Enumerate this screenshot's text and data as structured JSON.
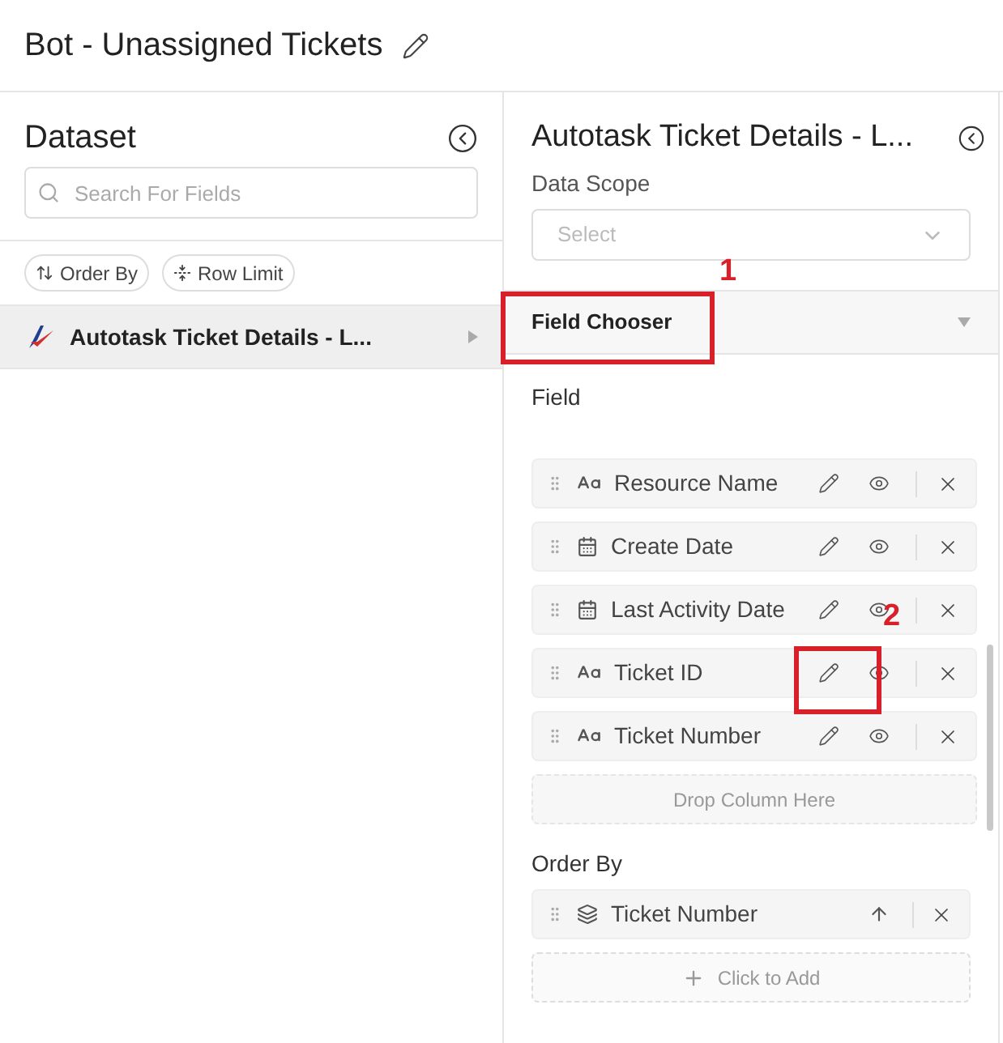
{
  "header": {
    "title": "Bot - Unassigned Tickets"
  },
  "dataset_panel": {
    "title": "Dataset",
    "search": {
      "placeholder": "Search For Fields"
    },
    "chips": [
      {
        "label": "Order By",
        "kind": "sort"
      },
      {
        "label": "Row Limit",
        "kind": "limit"
      }
    ],
    "datasets": [
      {
        "name": "Autotask Ticket Details - L...",
        "selected": true
      }
    ]
  },
  "details_panel": {
    "title": "Autotask Ticket Details - L...",
    "data_scope": {
      "label": "Data Scope",
      "placeholder": "Select"
    },
    "field_chooser": {
      "title": "Field Chooser",
      "expanded": true
    },
    "fields_label": "Field",
    "fields": [
      {
        "name": "Resource Name",
        "kind": "text"
      },
      {
        "name": "Create Date",
        "kind": "date"
      },
      {
        "name": "Last Activity Date",
        "kind": "date"
      },
      {
        "name": "Ticket ID",
        "kind": "text"
      },
      {
        "name": "Ticket Number",
        "kind": "text"
      }
    ],
    "drop_zone": "Drop Column Here",
    "order_by_label": "Order By",
    "order_by": [
      {
        "name": "Ticket Number",
        "ascending": true
      }
    ],
    "add_button": "Click to Add"
  },
  "annotations": [
    {
      "label": "1"
    },
    {
      "label": "2"
    }
  ]
}
